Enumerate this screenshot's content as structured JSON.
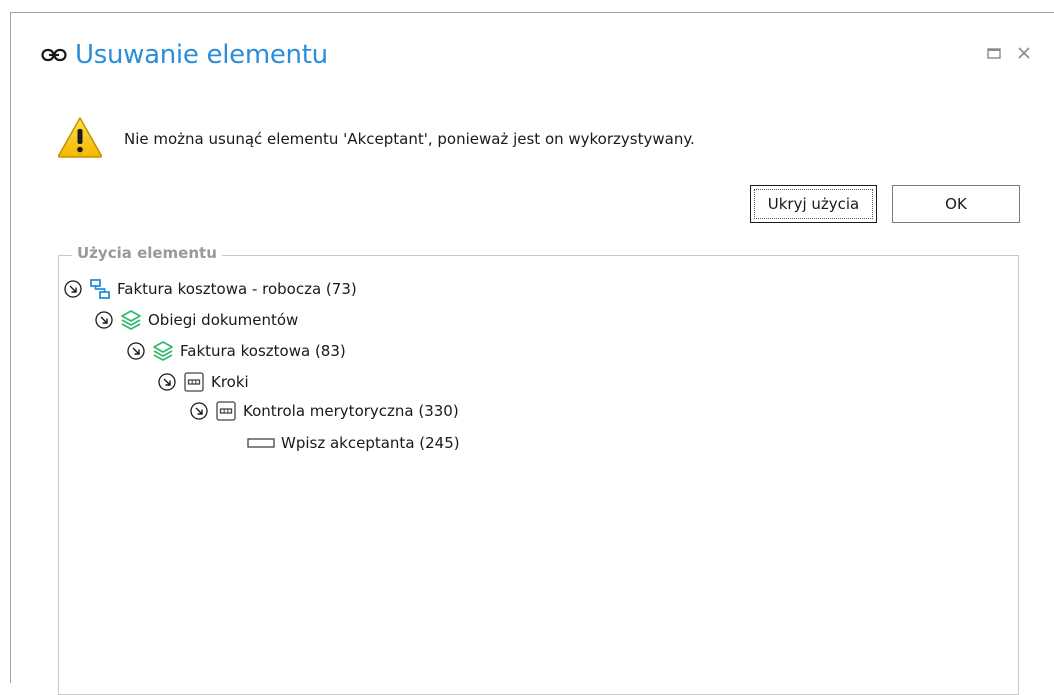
{
  "dialog": {
    "title": "Usuwanie elementu",
    "title_icon": "link-icon",
    "accent_color": "#2a8fd8",
    "window_controls": [
      "maximize-icon",
      "close-icon"
    ]
  },
  "message": {
    "icon": "warning-icon",
    "text": "Nie można usunąć elementu 'Akceptant', ponieważ jest on wykorzystywany."
  },
  "buttons": {
    "hide_usages": "Ukryj użycia",
    "ok": "OK"
  },
  "usages": {
    "label": "Użycia elementu",
    "tree": [
      {
        "label": "Faktura kosztowa - robocza (73)",
        "icon": "workflow-icon",
        "expanded": true
      },
      {
        "label": "Obiegi dokumentów",
        "icon": "layers-icon",
        "expanded": true
      },
      {
        "label": "Faktura kosztowa (83)",
        "icon": "layers-icon",
        "expanded": true
      },
      {
        "label": "Kroki",
        "icon": "step-icon",
        "expanded": true
      },
      {
        "label": "Kontrola merytoryczna (330)",
        "icon": "step-icon",
        "expanded": true
      },
      {
        "label": "Wpisz akceptanta (245)",
        "icon": "field-icon",
        "expanded": false
      }
    ]
  }
}
